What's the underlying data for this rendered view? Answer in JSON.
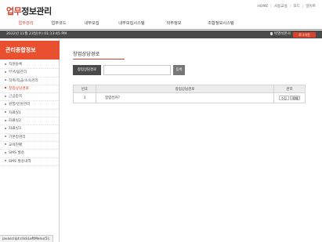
{
  "app": {
    "logo_accent": "업무",
    "logo_rest": "정보관리",
    "colors": {
      "accent": "#d9412a",
      "sidebar_header": "#e8502f",
      "statusbar": "#4a4a4a"
    }
  },
  "toplinks": [
    "HOME",
    "사용교실",
    "모드",
    "일이트"
  ],
  "gnb": {
    "items": [
      "업무관리",
      "업무코드",
      "내부모집",
      "내부모집시스템",
      "외부정보",
      "조합정보시스템"
    ],
    "active_index": 0
  },
  "statusbar": {
    "datetime": "2022년 11월 23일(수) 01:13:45 PM",
    "user": "박영석본사",
    "logout": "로그아웃"
  },
  "sidebar": {
    "title": "관리종합정보",
    "items": [
      "직원등록",
      "부서/팀관리",
      "직위/직급/소속관리",
      "창업상담경로",
      "근공중지",
      "원청/인원관리",
      "자료실1",
      "자료실2",
      "자료실3",
      "기본정관리",
      "교육현황",
      "SMS 발송",
      "SMS 발송내역"
    ],
    "active_index": 3
  },
  "main": {
    "title": "창업상담경로",
    "tag_button": "창업상담경로",
    "search": {
      "value": "",
      "placeholder": ""
    },
    "register_button": "등록",
    "table": {
      "headers": [
        "번호",
        "창업상담경로",
        "관리"
      ],
      "rows": [
        {
          "no": "1",
          "name": "창업컨커?",
          "edit": "수정",
          "delete": "삭제"
        }
      ]
    }
  },
  "browser_status": "javascript:clickLeftMenu(5);"
}
